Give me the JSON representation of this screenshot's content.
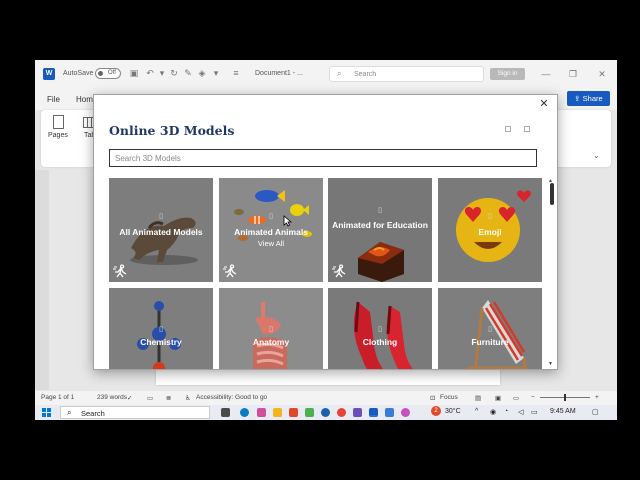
{
  "titlebar": {
    "word_logo": "W",
    "autosave": "AutoSave",
    "autosave_state": "Off",
    "doc_title": "Document1 - ...",
    "search_placeholder": "Search",
    "signin": "Sign in"
  },
  "menubar": {
    "file": "File",
    "home": "Hom",
    "share": "Share"
  },
  "ribbon": {
    "pages": "Pages",
    "table": "Tab"
  },
  "statusbar": {
    "page": "Page 1 of 1",
    "words": "239 words",
    "accessibility": "Accessibility: Good to go",
    "focus": "Focus"
  },
  "taskbar": {
    "search": "Search",
    "temp": "30°C",
    "time": "9:45 AM",
    "notif_count": "2"
  },
  "dialog": {
    "title": "Online 3D Models",
    "search_placeholder": "Search 3D Models",
    "tiles": [
      {
        "label": "All Animated Models",
        "animated": true
      },
      {
        "label": "Animated Animals",
        "sub": "View All",
        "animated": true
      },
      {
        "label": "Animated for Education",
        "animated": true
      },
      {
        "label": "Emoji",
        "animated": false
      },
      {
        "label": "Chemistry",
        "animated": false
      },
      {
        "label": "Anatomy",
        "animated": false
      },
      {
        "label": "Clothing",
        "animated": false
      },
      {
        "label": "Furniture",
        "animated": false
      }
    ]
  },
  "colors": {
    "accent": "#185abd",
    "title": "#1f3864",
    "tile_bg": "#6f6f6f"
  }
}
